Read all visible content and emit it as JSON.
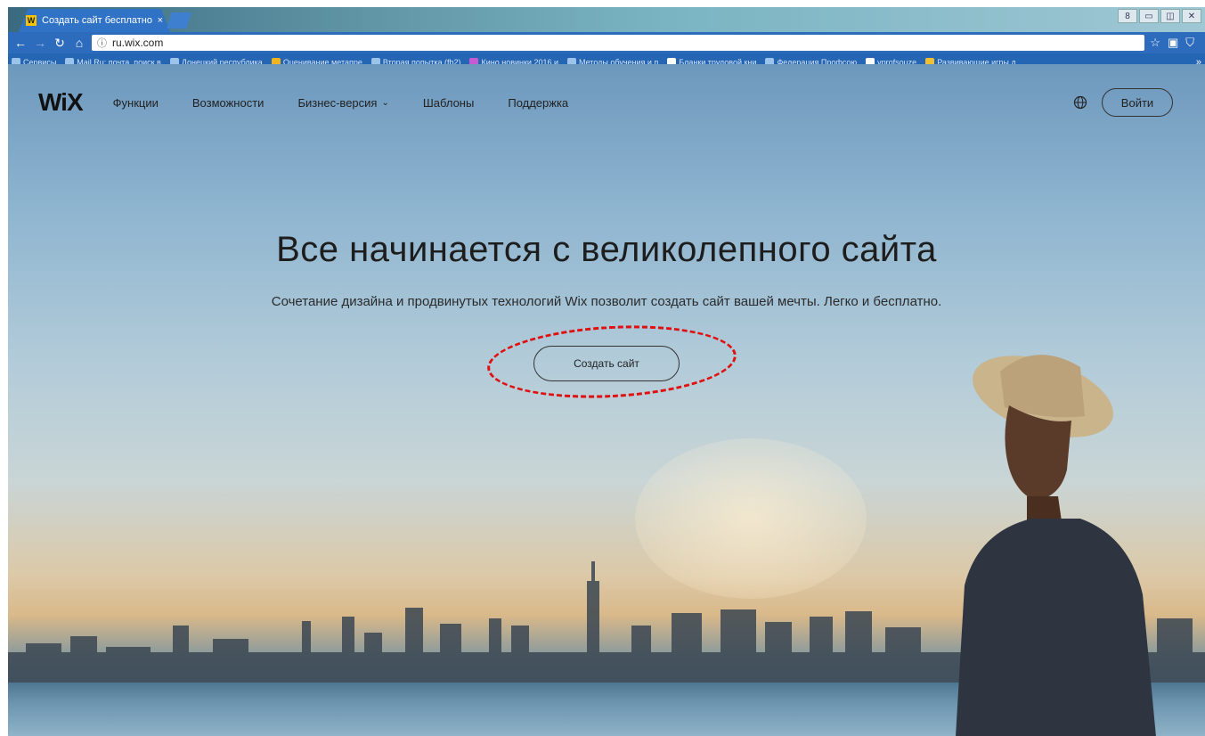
{
  "browser": {
    "tab_title": "Создать сайт бесплатно",
    "tab_close": "×",
    "address": "ru.wix.com",
    "window_controls": [
      "8",
      "▭",
      "◫",
      "✕"
    ],
    "bookmarks": [
      "Сервисы",
      "Mail.Ru: почта, поиск в",
      "Донецкий республика",
      "Оценивание метапре",
      "Вторая попытка (fb2)",
      "Кино новинки 2016 и",
      "Методы обучения и п",
      "Бланки трудовой кни",
      "Федерация Профсою",
      "vprofsouze",
      "Развивающие игры д"
    ],
    "bookmarks_more": "»"
  },
  "site": {
    "logo": "WiX",
    "nav": {
      "features": "Функции",
      "capabilities": "Возможности",
      "business": "Бизнес-версия",
      "templates": "Шаблоны",
      "support": "Поддержка"
    },
    "login": "Войти"
  },
  "hero": {
    "title": "Все начинается с великолепного сайта",
    "subtitle": "Сочетание дизайна и продвинутых технологий Wix позволит создать сайт вашей мечты. Легко и бесплатно.",
    "cta": "Создать сайт"
  },
  "colors": {
    "annotation": "#e01010",
    "chrome_blue": "#2d6bbd"
  }
}
